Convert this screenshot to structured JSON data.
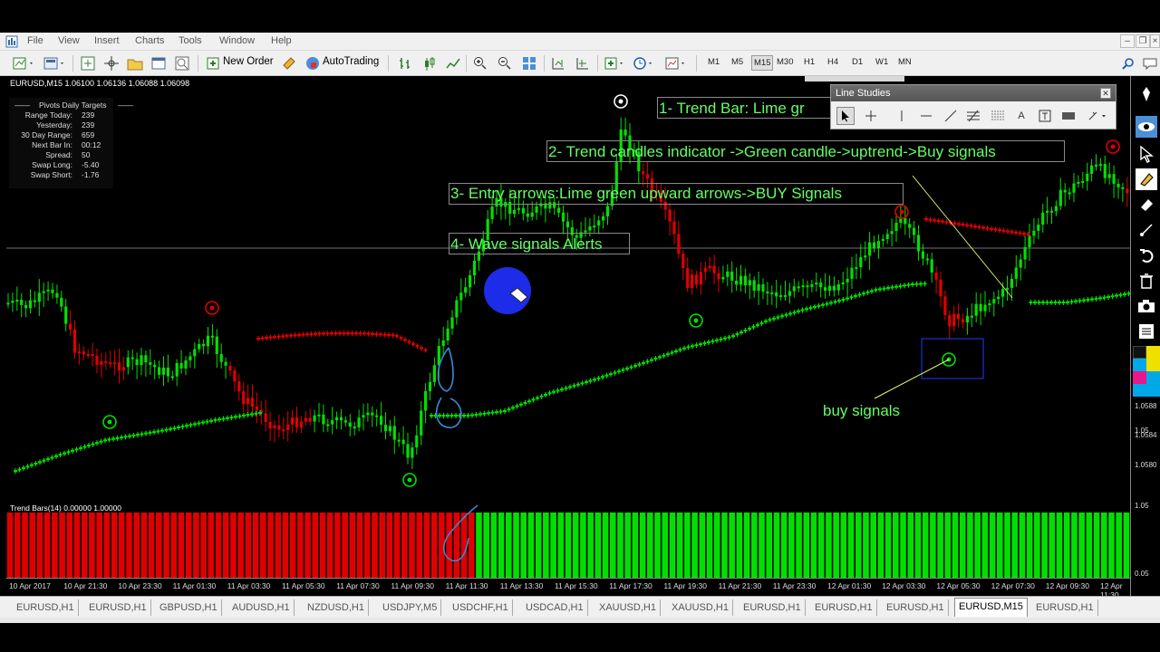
{
  "menu": {
    "items": [
      "File",
      "View",
      "Insert",
      "Charts",
      "Tools",
      "Window",
      "Help"
    ]
  },
  "toolbar": {
    "new_order": "New Order",
    "auto_trading": "AutoTrading",
    "timeframes": [
      "M1",
      "M5",
      "M15",
      "M30",
      "H1",
      "H4",
      "D1",
      "W1",
      "MN"
    ],
    "active_timeframe": "M15"
  },
  "chart": {
    "header": "EURUSD,M15  1.06100 1.06136 1.06088 1.06098",
    "pivots": {
      "title": "Pivots Daily Targets",
      "rows": [
        {
          "label": "Range  Today:",
          "value": "239"
        },
        {
          "label": "Yesterday:",
          "value": "239"
        },
        {
          "label": "30 Day Range:",
          "value": "659"
        },
        {
          "label": "Next Bar In:",
          "value": "00:12"
        },
        {
          "label": "Spread:",
          "value": "50"
        },
        {
          "label": "Swap  Long:",
          "value": "-5.40"
        },
        {
          "label": "Swap  Short:",
          "value": "-1.76"
        }
      ]
    },
    "annotations": {
      "a1": "1- Trend Bar: Lime gr",
      "a2": "2- Trend candles indicator ->Green candle->uptrend->Buy signals",
      "a3": "3- Entry arrows:Lime green upward arrows->BUY Signals",
      "a4": "4- Wave signals Alerts",
      "buy": "buy signals"
    },
    "colors": {
      "up": "#00e000",
      "down": "#e00000",
      "text": "#64ff64"
    }
  },
  "indicator": {
    "label": "Trend Bars(14) 0.00000 1.00000",
    "red_bars": 63,
    "green_bars": 88
  },
  "price_axis": {
    "labels": [
      "1.05",
      "1.0588",
      "1.0584",
      "1.0580",
      "1.05",
      "0.05"
    ]
  },
  "time_axis": {
    "labels": [
      "10 Apr 2017",
      "10 Apr 21:30",
      "10 Apr 23:30",
      "11 Apr 01:30",
      "11 Apr 03:30",
      "11 Apr 05:30",
      "11 Apr 07:30",
      "11 Apr 09:30",
      "11 Apr 11:30",
      "11 Apr 13:30",
      "11 Apr 15:30",
      "11 Apr 17:30",
      "11 Apr 19:30",
      "11 Apr 21:30",
      "11 Apr 23:30",
      "12 Apr 01:30",
      "12 Apr 03:30",
      "12 Apr 05:30",
      "12 Apr 07:30",
      "12 Apr 09:30",
      "12 Apr 11:30"
    ]
  },
  "tabs": [
    "EURUSD,H1",
    "EURUSD,H1",
    "GBPUSD,H1",
    "AUDUSD,H1",
    "NZDUSD,H1",
    "USDJPY,M5",
    "USDCHF,H1",
    "USDCAD,H1",
    "XAUUSD,H1",
    "XAUUSD,H1",
    "EURUSD,H1",
    "EURUSD,H1",
    "EURUSD,H1",
    "EURUSD,M15",
    "EURUSD,H1"
  ],
  "active_tab": 13,
  "line_studies": {
    "title": "Line Studies",
    "tools": [
      "cursor",
      "crosshair",
      "vertical-line",
      "horizontal-line",
      "trendline",
      "fibonacci",
      "channel",
      "text",
      "text-label",
      "rectangle",
      "more"
    ]
  }
}
